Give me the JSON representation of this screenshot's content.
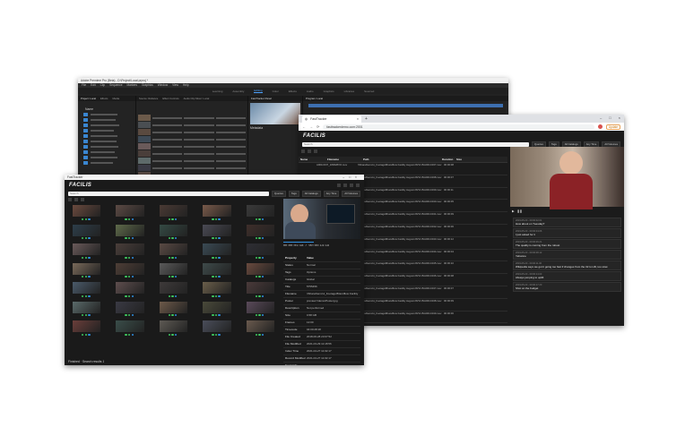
{
  "premiere": {
    "title": "Adobe Premiere Pro (Beta) - D:\\Project\\Local.prproj *",
    "menus": [
      "File",
      "Edit",
      "Clip",
      "Sequence",
      "Markers",
      "Graphics",
      "Window",
      "View",
      "Help"
    ],
    "workspaces": [
      "Learning",
      "Assembly",
      "Editing",
      "Color",
      "Effects",
      "Audio",
      "Graphics",
      "Libraries",
      "Sourced"
    ],
    "active_workspace": "Editing",
    "project_tabs": [
      "Project: Local",
      "Effects",
      "Media"
    ],
    "bin_header": "Name",
    "fasttracker_panel_tabs": [
      "Source: Reliance",
      "Effect Controls",
      "Audio Clip Mixer: Local",
      "FastTracker Panel",
      "Metadata"
    ],
    "program_tab": "Program: Local"
  },
  "browser": {
    "tab_title": "FastTracker",
    "url": "fasttrackerdemo.com:2001",
    "update_label": "Update",
    "logo": "FACILIS",
    "search_placeholder": "Search",
    "filter_buttons": [
      "Queries",
      "Tags",
      "All Catalogs",
      "Any Time",
      "All Volumes"
    ],
    "columns": [
      "Name",
      "Filename",
      "Path",
      "Duration",
      "Size"
    ],
    "rows": [
      {
        "file": "A001C037_180628XO.mov",
        "path": "\\\\ShareDemo\\1_Footage\\Brandflow Facility August 26/V1 B/A001C037.mov",
        "dur": "00:00:08"
      },
      {
        "file": "A001C038_180628XO.mov",
        "path": "\\\\ShareDemo\\1_Footage\\Brandflow Facility August 26/V1 B/A001C038.mov",
        "dur": "00:00:07"
      },
      {
        "file": "A001C039_180628XO.mov",
        "path": "\\\\ShareDemo\\1_Footage\\Brandflow Facility August 26/V1 B/A001C039.mov",
        "dur": "00:00:11"
      },
      {
        "file": "A001C040_180628XO.mov",
        "path": "\\\\ShareDemo\\1_Footage\\Brandflow Facility August 26/V1 B/A001C040.mov",
        "dur": "00:00:05"
      },
      {
        "file": "A001C041_180628XO.mov",
        "path": "\\\\ShareDemo\\1_Footage\\Brandflow Facility August 26/V1 B/A001C041.mov",
        "dur": "00:00:09"
      },
      {
        "file": "A001C042_180628XO.mov",
        "path": "\\\\ShareDemo\\1_Footage\\Brandflow Facility August 26/V1 B/A001C042.mov",
        "dur": "00:00:06"
      },
      {
        "file": "A001C043_180628XO.mov",
        "path": "\\\\ShareDemo\\1_Footage\\Brandflow Facility August 26/V1 B/A001C043.mov",
        "dur": "00:00:12"
      },
      {
        "file": "A001C044_180628XO.mov",
        "path": "\\\\ShareDemo\\1_Footage\\Brandflow Facility August 26/V1 B/A001C044.mov",
        "dur": "00:00:04"
      },
      {
        "file": "A001C045_180628XO.mov",
        "path": "\\\\ShareDemo\\1_Footage\\Brandflow Facility August 26/V1 B/A001C045.mov",
        "dur": "00:00:10"
      },
      {
        "file": "A001C046_180628XO.mov",
        "path": "\\\\ShareDemo\\1_Footage\\Brandflow Facility August 26/V1 B/A001C046.mov",
        "dur": "00:00:08"
      },
      {
        "file": "A001C047_180628XO.mov",
        "path": "\\\\ShareDemo\\1_Footage\\Brandflow Facility August 26/V1 B/A001C047.mov",
        "dur": "00:00:07"
      },
      {
        "file": "A001C048_180628XO.mov",
        "path": "\\\\ShareDemo\\1_Footage\\Brandflow Facility August 26/V1 B/A001C048.mov",
        "dur": "00:00:09"
      },
      {
        "file": "A001C049_180628XO.mov",
        "path": "\\\\ShareDemo\\1_Footage\\Brandflow Facility August 26/V1 B/A001C049.mov",
        "dur": "00:00:06"
      }
    ],
    "comments": [
      {
        "ts": "2019-05-20 - 00:00:02.01",
        "text": "How about on Tuesday?"
      },
      {
        "ts": "2019-05-20 - 00:00:04.06",
        "text": "I just asked for it"
      },
      {
        "ts": "2019-05-20 - 00:00:06.21",
        "text": "The quality is coming from the robust"
      },
      {
        "ts": "2019-05-20 - 00:00:08.12",
        "text": "Yebanne"
      },
      {
        "ts": "2019-05-20 - 00:00:11.00",
        "text": "Wikipedia says we got it going too fast if changes from the 32 to HD, too slow"
      },
      {
        "ts": "2019-05-20 - 00:00:14.03",
        "text": "Always jumping to uplift"
      },
      {
        "ts": "2019-05-20 - 00:00:17.20",
        "text": "Shot on the budget"
      }
    ]
  },
  "facilis": {
    "title": "FastTracker",
    "logo": "FACILIS",
    "search_placeholder": "Search",
    "filter_buttons": [
      "Queries",
      "Tags",
      "All Catalogs",
      "Any Time",
      "All Volumes"
    ],
    "timecode": "00:00:01:18 / 00:00:14:18",
    "properties": [
      {
        "k": "Property",
        "v": "Value"
      },
      {
        "k": "Status",
        "v": "Normal"
      },
      {
        "k": "Tags",
        "v": "Options"
      },
      {
        "k": "Catalogs",
        "v": "Global"
      },
      {
        "k": "Title",
        "v": "5755456"
      },
      {
        "k": "Filename",
        "v": "\\\\ShareDemo\\1_Footage\\Brandflow Facility"
      },
      {
        "k": "Poster",
        "v": "preview://demo/Poster.jpg"
      },
      {
        "k": "Description",
        "v": "Not performed"
      },
      {
        "k": "Size",
        "v": "0.58 GB"
      },
      {
        "k": "Frames",
        "v": "12:00"
      },
      {
        "k": "Timecode",
        "v": "04:00:28:18"
      },
      {
        "k": "File Created",
        "v": "2018-06-28 23:07:52"
      },
      {
        "k": "File Modified",
        "v": "2021-03-29 11:18:56"
      },
      {
        "k": "Index Time",
        "v": "2021-04-27 11:02:17"
      },
      {
        "k": "Record Modified",
        "v": "2021-04-27 11:02:17"
      },
      {
        "k": "Keywords",
        "v": ""
      },
      {
        "k": "Notes",
        "v": ""
      }
    ],
    "status": "Finished · Search results 1",
    "thumb_colors": [
      "#6b4a3e",
      "#5c4a44",
      "#4a3a34",
      "#7a5a4a",
      "#3a3a3a",
      "#2d3e4a",
      "#5e6a4a",
      "#344a44",
      "#4a4a54",
      "#3e2e2a",
      "#6a5a5a",
      "#4a3e3a",
      "#5a4a44",
      "#3a4a54",
      "#2e2e34",
      "#7a6a5a",
      "#4e3e36",
      "#5a5a5a",
      "#3e4a4a",
      "#6a4a3e",
      "#4a5a6a",
      "#5e4e4e",
      "#3e3a3a",
      "#6a5e4a",
      "#4a3a3a",
      "#5a6a6a",
      "#3a3a44",
      "#6e5a4a",
      "#4a4a3a",
      "#5a4a5a",
      "#6a3e3a",
      "#3a4e4a",
      "#5e5a54",
      "#4a4e5a",
      "#6a5a4e"
    ]
  }
}
